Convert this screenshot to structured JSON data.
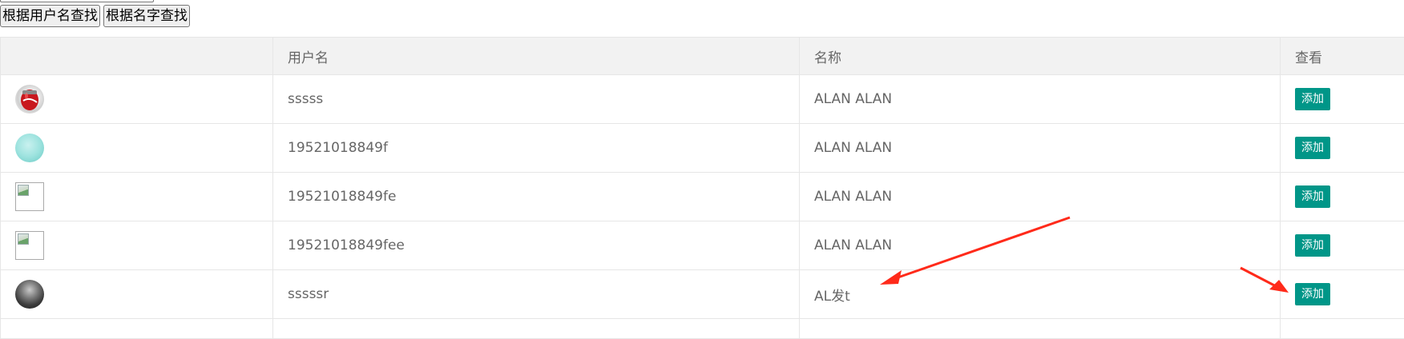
{
  "search": {
    "by_username_label": "根据用户名查找",
    "by_name_label": "根据名字查找"
  },
  "table": {
    "columns": [
      "",
      "用户名",
      "名称",
      "查看"
    ],
    "rows": [
      {
        "avatar": "coke-can-avatar",
        "username": "sssss",
        "name": "ALAN ALAN",
        "action": "添加"
      },
      {
        "avatar": "cyan-blob-avatar",
        "username": "19521018849f",
        "name": "ALAN ALAN",
        "action": "添加"
      },
      {
        "avatar": "broken-image-icon",
        "username": "19521018849fe",
        "name": "ALAN ALAN",
        "action": "添加"
      },
      {
        "avatar": "broken-image-icon",
        "username": "19521018849fee",
        "name": "ALAN ALAN",
        "action": "添加"
      },
      {
        "avatar": "night-scene-avatar",
        "username": "sssssr",
        "name": "AL发t",
        "action": "添加"
      }
    ]
  },
  "colors": {
    "add_button": "#009688",
    "annotation_arrow": "#ff2a1a",
    "header_bg": "#f2f2f2"
  }
}
